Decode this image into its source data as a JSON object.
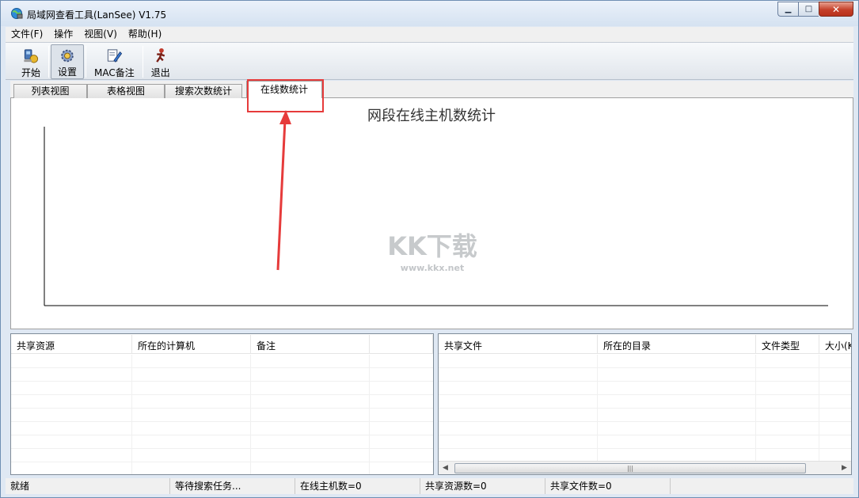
{
  "window": {
    "title": "局域网查看工具(LanSee) V1.75",
    "controls": {
      "minimize": "▁",
      "maximize": "□",
      "close": "✕"
    }
  },
  "menu": [
    "文件(F)",
    "操作",
    "视图(V)",
    "帮助(H)"
  ],
  "toolbar": {
    "start": "开始",
    "settings": "设置",
    "mac_note": "MAC备注",
    "exit": "退出"
  },
  "tabs": [
    "列表视图",
    "表格视图",
    "搜索次数统计",
    "在线数统计"
  ],
  "active_tab": "在线数统计",
  "chart_data": {
    "type": "line",
    "title": "网段在线主机数统计",
    "series": [],
    "xlabel": "",
    "ylabel": ""
  },
  "shares_list": {
    "columns": [
      "共享资源",
      "所在的计算机",
      "备注",
      ""
    ]
  },
  "files_list": {
    "columns": [
      "共享文件",
      "所在的目录",
      "文件类型",
      "大小(K"
    ],
    "scroll_grip": "|||"
  },
  "status": [
    "就绪",
    "等待搜索任务...",
    "在线主机数=0",
    "共享资源数=0",
    "共享文件数=0"
  ],
  "watermark": {
    "logo": "KK下载",
    "url": "www.kkx.net"
  },
  "colors": {
    "annotation": "#e63b3b"
  }
}
